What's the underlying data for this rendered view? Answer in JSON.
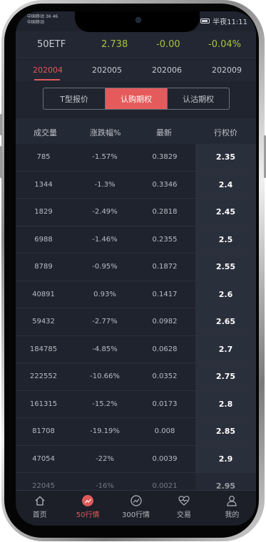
{
  "status_bar": {
    "carrier_1": "中国移动 36 46",
    "carrier_2": "中国移动 ",
    "time": "半夜11:11"
  },
  "quote": {
    "name": "50ETF",
    "price": "2.738",
    "change": "-0.00",
    "change_pct": "-0.04%"
  },
  "month_tabs": [
    "202004",
    "202005",
    "202006",
    "202009"
  ],
  "active_month": "202004",
  "segments": [
    "T型报价",
    "认购期权",
    "认沽期权"
  ],
  "active_segment": "认购期权",
  "table": {
    "headers": [
      "成交量",
      "涨跌幅%",
      "最新",
      "行权价"
    ],
    "rows": [
      [
        "785",
        "-1.57%",
        "0.3829",
        "2.35"
      ],
      [
        "1344",
        "-1.3%",
        "0.3346",
        "2.4"
      ],
      [
        "1829",
        "-2.49%",
        "0.2818",
        "2.45"
      ],
      [
        "6988",
        "-1.46%",
        "0.2355",
        "2.5"
      ],
      [
        "8789",
        "-0.95%",
        "0.1872",
        "2.55"
      ],
      [
        "40891",
        "0.93%",
        "0.1417",
        "2.6"
      ],
      [
        "59432",
        "-2.77%",
        "0.0982",
        "2.65"
      ],
      [
        "184785",
        "-4.85%",
        "0.0628",
        "2.7"
      ],
      [
        "222552",
        "-10.66%",
        "0.0352",
        "2.75"
      ],
      [
        "161315",
        "-15.2%",
        "0.0173",
        "2.8"
      ],
      [
        "81708",
        "-19.19%",
        "0.008",
        "2.85"
      ],
      [
        "47054",
        "-22%",
        "0.0039",
        "2.9"
      ],
      [
        "22045",
        "-16%",
        "0.0021",
        "2.95"
      ]
    ]
  },
  "tabbar": [
    {
      "label": "首页",
      "icon": "home-icon"
    },
    {
      "label": "50行情",
      "icon": "trend-icon"
    },
    {
      "label": "300行情",
      "icon": "trend-circle-icon"
    },
    {
      "label": "交易",
      "icon": "heart-pulse-icon"
    },
    {
      "label": "我的",
      "icon": "user-icon"
    }
  ],
  "active_tab": "50行情",
  "colors": {
    "accent": "#e05a5a",
    "quote_green": "#a6c53c",
    "background": "#1f232e"
  }
}
